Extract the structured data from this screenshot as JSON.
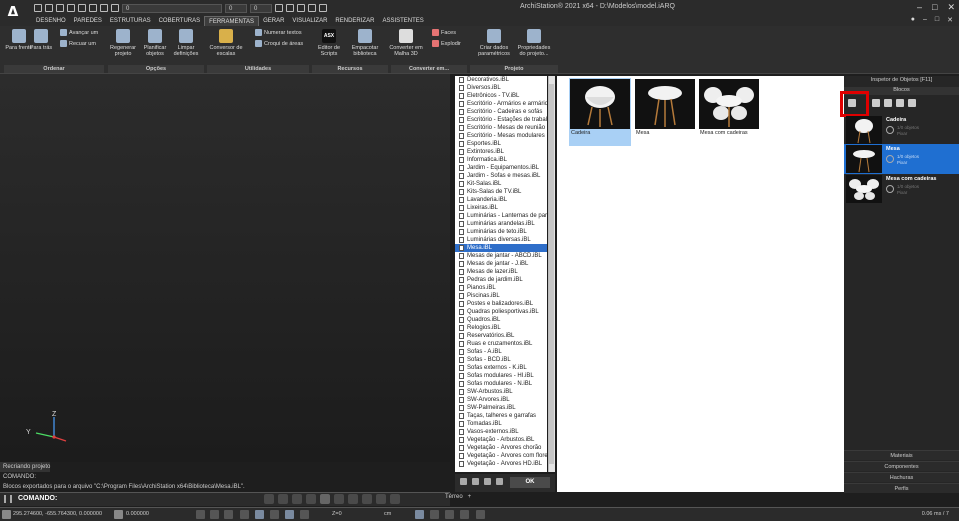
{
  "titlebar": {
    "title": "ArchiStation® 2021 x64  -  D:\\Modelos\\model.iARQ",
    "layer_value": "0",
    "num1": "0",
    "num2": "0",
    "win_controls": [
      "–",
      "□",
      "✕"
    ]
  },
  "menu": {
    "items": [
      "DESENHO",
      "PAREDES",
      "ESTRUTURAS",
      "COBERTURAS",
      "FERRAMENTAS",
      "GERAR",
      "VISUALIZAR",
      "RENDERIZAR",
      "ASSISTENTES"
    ],
    "active": "FERRAMENTAS"
  },
  "ribbon": {
    "buttons": [
      {
        "label": "Para frente",
        "icon": "layers-front-icon"
      },
      {
        "label": "Para trás",
        "icon": "layers-back-icon"
      },
      {
        "label": "Regenerar projeto",
        "icon": "regenerate-icon"
      },
      {
        "label": "Planificar objetos",
        "icon": "flatten-icon"
      },
      {
        "label": "Limpar definições",
        "icon": "broom-icon"
      },
      {
        "label": "Conversor de escalas",
        "icon": "scale-converter-icon"
      },
      {
        "label": "Editor de Scripts",
        "icon": "script-editor-icon"
      },
      {
        "label": "Empacotar biblioteca",
        "icon": "package-icon"
      },
      {
        "label": "Converter em Malha 3D",
        "icon": "mesh-icon"
      },
      {
        "label": "Criar dados paramétricos",
        "icon": "parametric-icon"
      },
      {
        "label": "Propriedades do projeto...",
        "icon": "project-properties-icon"
      }
    ],
    "small": {
      "avancar": "Avançar um",
      "recuar": "Recuar um",
      "numerar": "Numerar textos",
      "croqui": "Croqui de áreas",
      "faces": "Faces",
      "explodir": "Explodir",
      "asx": "ASX"
    },
    "groups": [
      "Ordenar",
      "Opções",
      "Utilidades",
      "Recursos",
      "Converter em...",
      "Projeto"
    ]
  },
  "library": {
    "files": [
      "Decorativos.iBL",
      "Diversos.iBL",
      "Eletrônicos - TV.iBL",
      "Escritório - Armários e armários",
      "Escritório - Cadeiras e sofás",
      "Escritório - Estações de trabalho",
      "Escritório - Mesas de reunião",
      "Escritório - Mesas modulares",
      "Esportes.iBL",
      "Extintores.iBL",
      "Informatica.iBL",
      "Jardim - Equipamentos.iBL",
      "Jardim - Sofas e mesas.iBL",
      "Kit-Salas.iBL",
      "Kits-Salas de TV.iBL",
      "Lavanderia.iBL",
      "Lixeiras.iBL",
      "Luminárias - Lanternas de parede",
      "Luminárias arandelas.iBL",
      "Luminárias de teto.iBL",
      "Luminárias diversas.iBL",
      "Mesa.iBL",
      "Mesas de jantar - ABCD.iBL",
      "Mesas de jantar - J.iBL",
      "Mesas de lazer.iBL",
      "Pedras de jardim.iBL",
      "Pianos.iBL",
      "Piscinas.iBL",
      "Postes e balizadores.iBL",
      "Quadras poliesportivas.iBL",
      "Quadros.iBL",
      "Relogios.iBL",
      "Reservatórios.iBL",
      "Ruas e cruzamentos.iBL",
      "Sofas - A.iBL",
      "Sofas - BCD.iBL",
      "Sofas externos - K.iBL",
      "Sofas modulares - HI.iBL",
      "Sofas modulares - N.iBL",
      "SW-Arbustos.iBL",
      "SW-Arvores.iBL",
      "SW-Palmeiras.iBL",
      "Taças, talheres e garrafas",
      "Tomadas.iBL",
      "Vasos-externos.iBL",
      "Vegetação - Arbustos.iBL",
      "Vegetação - Árvores chorão",
      "Vegetação - Árvores com flores",
      "Vegetação - Árvores HD.iBL"
    ],
    "selected_index": 21,
    "ok_label": "OK",
    "thumbnails": [
      "Cadeira",
      "Mesa",
      "Mesa com cadeiras"
    ]
  },
  "inspector": {
    "title": "Inspetor de Objetos [F11]",
    "tab": "Blocos",
    "blocks": [
      {
        "name": "Cadeira",
        "sub": "1/0 objetos",
        "flag": "Pixar"
      },
      {
        "name": "Mesa",
        "sub": "1/0 objetos",
        "flag": "Pixar"
      },
      {
        "name": "Mesa com cadeiras",
        "sub": "1/0 objetos",
        "flag": "Pixar"
      }
    ],
    "selected_block": 1,
    "panels": [
      "Materiais",
      "Componentes",
      "Hachuras",
      "Perfis"
    ]
  },
  "command": {
    "log": [
      "Recriando projeto",
      "COMANDO:",
      "Blocos exportados para o arquivo \"C:\\Program Files\\ArchiStation x64\\Biblioteca\\Mesa.iBL\"."
    ],
    "prompt": "COMANDO:"
  },
  "viewtabs": {
    "tab": "Térreo",
    "add": "+"
  },
  "status": {
    "coords": "295.274600, -655.764300, 0.000000",
    "angle": "0.000000",
    "z": "Z=0",
    "unit": "cm",
    "timing": "0.06 ms / 7"
  },
  "axes": {
    "z": "Z",
    "y": "Y"
  },
  "colors": {
    "accent": "#1f6fd1",
    "highlight_box": "#e00000"
  }
}
